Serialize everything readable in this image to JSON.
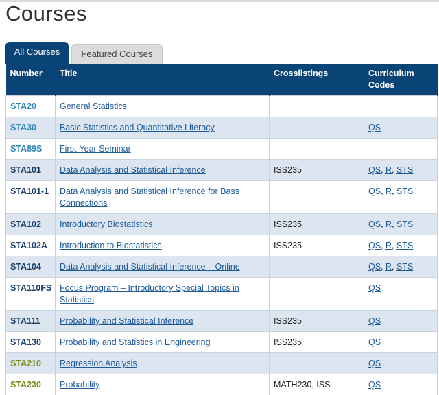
{
  "page": {
    "title": "Courses"
  },
  "tabs": [
    {
      "label": "All Courses",
      "active": true
    },
    {
      "label": "Featured Courses",
      "active": false
    }
  ],
  "table": {
    "headers": {
      "number": "Number",
      "title": "Title",
      "crosslistings": "Crosslistings",
      "codes": "Curriculum Codes"
    },
    "rows": [
      {
        "number": "STA20",
        "title": "General Statistics",
        "cross": "",
        "codes": [],
        "numcolor": "blue"
      },
      {
        "number": "STA30",
        "title": "Basic Statistics and Quantitative Literacy",
        "cross": "",
        "codes": [
          "QS"
        ],
        "numcolor": "blue"
      },
      {
        "number": "STA89S",
        "title": "First-Year Seminar",
        "cross": "",
        "codes": [],
        "numcolor": "blue"
      },
      {
        "number": "STA101",
        "title": "Data Analysis and Statistical Inference",
        "cross": "ISS235",
        "codes": [
          "QS",
          "R",
          "STS"
        ],
        "numcolor": "dark"
      },
      {
        "number": "STA101-1",
        "title": "Data Analysis and Statistical Inference for Bass Connections",
        "cross": "",
        "codes": [
          "QS",
          "R",
          "STS"
        ],
        "numcolor": "dark"
      },
      {
        "number": "STA102",
        "title": "Introductory Biostatistics",
        "cross": "ISS235",
        "codes": [
          "QS",
          "R",
          "STS"
        ],
        "numcolor": "dark"
      },
      {
        "number": "STA102A",
        "title": "Introduction to Biostatistics",
        "cross": "ISS235",
        "codes": [
          "QS",
          "R",
          "STS"
        ],
        "numcolor": "dark"
      },
      {
        "number": "STA104",
        "title": "Data Analysis and Statistical Inference – Online",
        "cross": "",
        "codes": [
          "QS",
          "R",
          "STS"
        ],
        "numcolor": "dark"
      },
      {
        "number": "STA110FS",
        "title": "Focus Program – Introductory Special Topics in Statistics",
        "cross": "",
        "codes": [
          "QS"
        ],
        "numcolor": "dark"
      },
      {
        "number": "STA111",
        "title": "Probability and Statistical Inference",
        "cross": "ISS235",
        "codes": [
          "QS"
        ],
        "numcolor": "dark"
      },
      {
        "number": "STA130",
        "title": "Probability and Statistics in Engineering",
        "cross": "ISS235",
        "codes": [
          "QS"
        ],
        "numcolor": "dark"
      },
      {
        "number": "STA210",
        "title": "Regression Analysis",
        "cross": "",
        "codes": [
          "QS"
        ],
        "numcolor": "olive"
      },
      {
        "number": "STA230",
        "title": "Probability",
        "cross": "MATH230, ISS",
        "codes": [
          "QS"
        ],
        "numcolor": "olive"
      }
    ]
  },
  "colors": {
    "header_bg": "#0a4375",
    "alt_row": "#dde6f0",
    "link": "#1d5a9a",
    "number_blue": "#2b86b8",
    "number_olive": "#7a8a14"
  }
}
